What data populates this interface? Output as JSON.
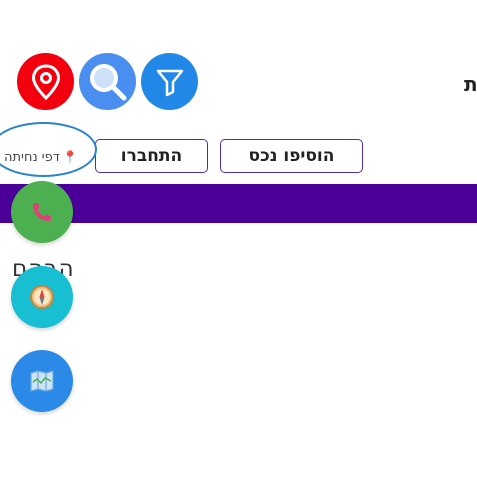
{
  "header": {
    "partial_title": "ת"
  },
  "icons": {
    "pin": "map-pin-icon",
    "search": "search-icon",
    "filter": "filter-icon",
    "phone": "phone-icon",
    "compass": "compass-icon",
    "map": "map-icon"
  },
  "buttons": {
    "add_property_label": "הוסיפו נכס",
    "login_label": "התחברו"
  },
  "location": {
    "label": "דפי נחיתה"
  },
  "content": {
    "partial_text": "הבהם"
  },
  "colors": {
    "nav_bar": "#4b0099",
    "pin_button": "#f2000d",
    "search_button": "#4a8ff0",
    "filter_button": "#2288e8",
    "phone_fab": "#4caf50",
    "compass_fab": "#18bfd2",
    "map_fab": "#2b8ae8",
    "button_border": "#5a2a99",
    "annotation_circle": "#2a84c9"
  }
}
